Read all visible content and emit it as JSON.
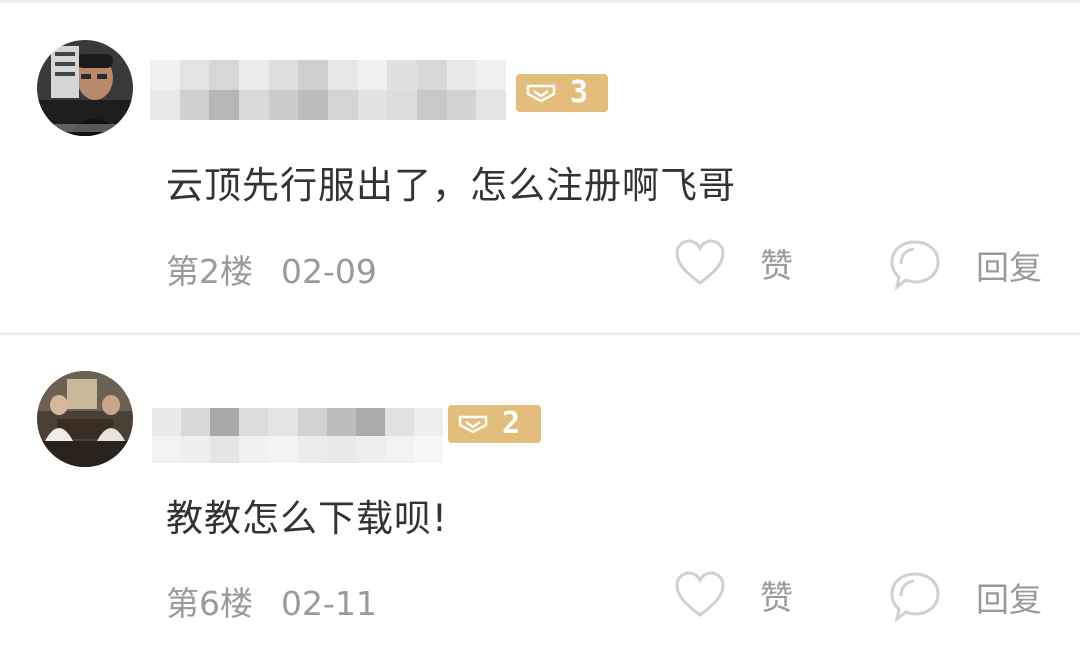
{
  "comments": [
    {
      "level": "3",
      "text": "云顶先行服出了，怎么注册啊飞哥",
      "floor": "第2楼",
      "date": "02-09",
      "like_label": "赞",
      "reply_label": "回复"
    },
    {
      "level": "2",
      "text": "教教怎么下载呗!",
      "floor": "第6楼",
      "date": "02-11",
      "like_label": "赞",
      "reply_label": "回复"
    }
  ],
  "colors": {
    "badge": "#e2bd7b",
    "content_text": "#333333",
    "meta_text": "#9a9a9a",
    "icon_stroke": "#d0d0d0"
  },
  "icons": [
    "avatar",
    "level-badge-icon",
    "heart-icon",
    "chat-bubble-icon"
  ]
}
